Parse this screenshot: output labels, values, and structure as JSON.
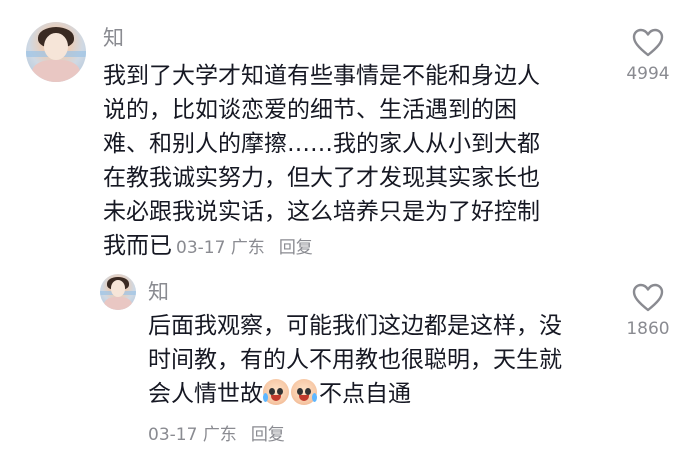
{
  "comments": [
    {
      "username": "知",
      "text_lines": [
        "我到了大学才知道有些事情是不能和身边人",
        "说的，比如谈恋爱的细节、生活遇到的困",
        "难、和别人的摩擦……我的家人从小到大都",
        "在教我诚实努力，但大了才发现其实家长也",
        "未必跟我说实话，这么培养只是为了好控制",
        "我而已"
      ],
      "date": "03-17",
      "location": "广东",
      "reply_label": "回复",
      "likes": "4994",
      "like_icon": "heart-outline-icon"
    },
    {
      "username": "知",
      "text_lines": [
        "后面我观察，可能我们这边都是这样，没",
        "时间教，有的人不用教也很聪明，天生就",
        "会人情世故"
      ],
      "text_tail": "不点自通",
      "emoji_icon": "crying-laughing-emoji-icon",
      "date": "03-17",
      "location": "广东",
      "reply_label": "回复",
      "likes": "1860",
      "like_icon": "heart-outline-icon"
    }
  ]
}
